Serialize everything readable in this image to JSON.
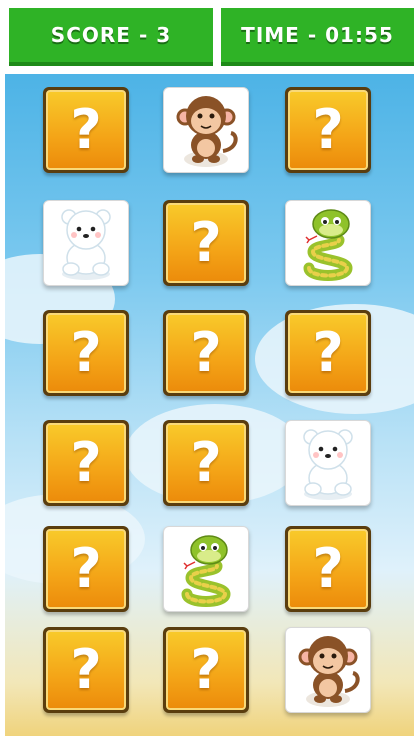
{
  "hud": {
    "score_label": "SCORE",
    "separator": "-",
    "score_value": "3",
    "time_label": "TIME",
    "time_value": "01:55"
  },
  "board": {
    "rows": 6,
    "columns": 3,
    "cards": [
      {
        "state": "hidden",
        "symbol": "?"
      },
      {
        "state": "revealed",
        "animal": "monkey"
      },
      {
        "state": "hidden",
        "symbol": "?"
      },
      {
        "state": "revealed",
        "animal": "polar-bear"
      },
      {
        "state": "hidden",
        "symbol": "?"
      },
      {
        "state": "revealed",
        "animal": "snake"
      },
      {
        "state": "hidden",
        "symbol": "?"
      },
      {
        "state": "hidden",
        "symbol": "?"
      },
      {
        "state": "hidden",
        "symbol": "?"
      },
      {
        "state": "hidden",
        "symbol": "?"
      },
      {
        "state": "hidden",
        "symbol": "?"
      },
      {
        "state": "revealed",
        "animal": "polar-bear"
      },
      {
        "state": "hidden",
        "symbol": "?"
      },
      {
        "state": "revealed",
        "animal": "snake"
      },
      {
        "state": "hidden",
        "symbol": "?"
      },
      {
        "state": "hidden",
        "symbol": "?"
      },
      {
        "state": "hidden",
        "symbol": "?"
      },
      {
        "state": "revealed",
        "animal": "monkey"
      }
    ]
  },
  "colors": {
    "hud_green": "#2fb326",
    "card_gold": "#f4a417",
    "sky": "#7cc9ef"
  }
}
